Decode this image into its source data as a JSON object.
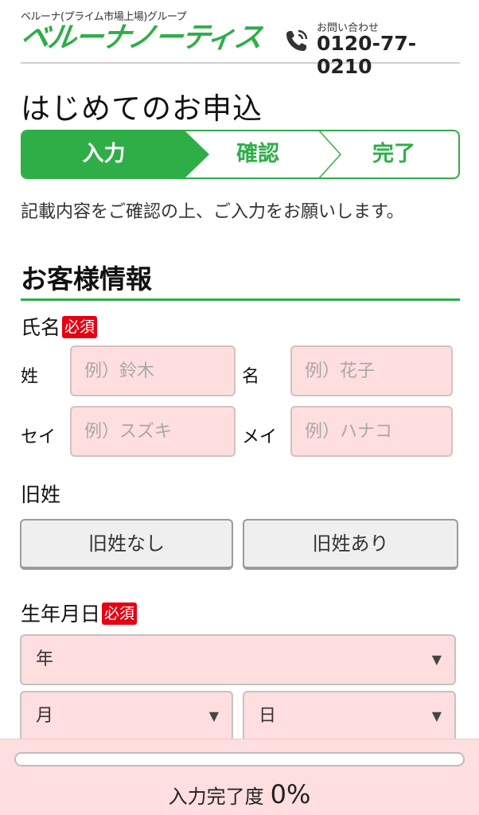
{
  "header": {
    "company_note": "ベルーナ(プライム市場上場)グループ",
    "logo_text": "ベルーナノーティス",
    "contact_label": "お問い合わせ",
    "contact_number": "0120-77-0210"
  },
  "page_title": "はじめてのお申込",
  "steps": [
    {
      "label": "入力",
      "active": true
    },
    {
      "label": "確認",
      "active": false
    },
    {
      "label": "完了",
      "active": false
    }
  ],
  "intro": "記載内容をご確認の上、ご入力をお願いします。",
  "section": {
    "title": "お客様情報",
    "required_badge": "必須",
    "name": {
      "label": "氏名",
      "last_label": "姓",
      "last_placeholder": "例）鈴木",
      "first_label": "名",
      "first_placeholder": "例）花子",
      "last_kana_label": "セイ",
      "last_kana_placeholder": "例）スズキ",
      "first_kana_label": "メイ",
      "first_kana_placeholder": "例）ハナコ"
    },
    "maiden_name": {
      "label": "旧姓",
      "option_none": "旧姓なし",
      "option_exists": "旧姓あり"
    },
    "birthdate": {
      "label": "生年月日",
      "year": "年",
      "month": "月",
      "day": "日"
    }
  },
  "progress": {
    "label": "入力完了度",
    "value_text": "0%",
    "value": 0
  },
  "colors": {
    "brand_green": "#2fae48",
    "required_red": "#e60012",
    "input_pink": "#ffdedf"
  },
  "icons": {
    "phone": "phone-icon",
    "caret": "caret-down-icon"
  }
}
